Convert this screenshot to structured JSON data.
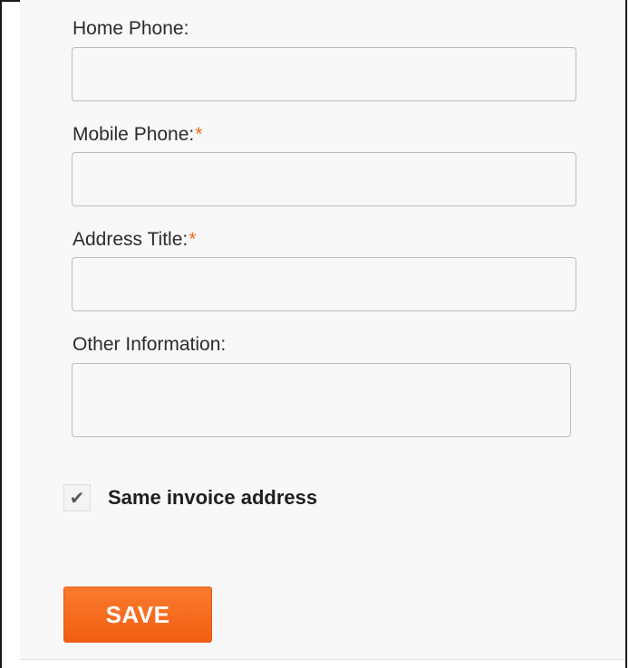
{
  "form": {
    "home_phone": {
      "label": "Home Phone:",
      "value": ""
    },
    "mobile_phone": {
      "label": "Mobile Phone:",
      "required_mark": "*",
      "value": ""
    },
    "address_title": {
      "label": "Address Title:",
      "required_mark": "*",
      "value": ""
    },
    "other_information": {
      "label": "Other Information:",
      "value": ""
    },
    "same_invoice": {
      "label": "Same invoice address",
      "checked": true,
      "icon": "checkmark-icon"
    },
    "save_label": "SAVE"
  },
  "colors": {
    "accent": "#f26a21",
    "panel_background": "#f8f8f8",
    "label_text": "#2b2b2b"
  }
}
